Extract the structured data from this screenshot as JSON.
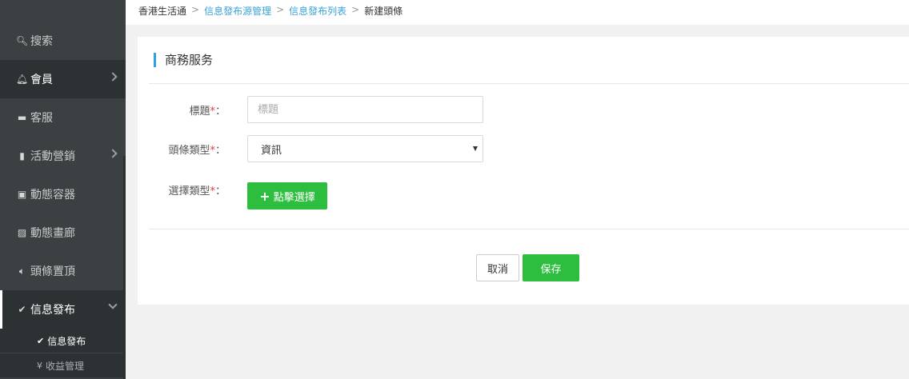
{
  "sidebar": {
    "items": [
      {
        "icon": "search-icon",
        "glyph": "🔍︎",
        "label": "搜索"
      },
      {
        "icon": "bell-icon",
        "glyph": "🔔︎",
        "label": "會員"
      },
      {
        "icon": "chat-icon",
        "glyph": "▬",
        "label": "客服"
      },
      {
        "icon": "bookmark-icon",
        "glyph": "▮",
        "label": "活動營銷"
      },
      {
        "icon": "inbox-icon",
        "glyph": "▣",
        "label": "動態容器"
      },
      {
        "icon": "picture-icon",
        "glyph": "▨",
        "label": "動態畫廊"
      },
      {
        "icon": "volume-icon",
        "glyph": "🔈︎",
        "label": "頭條置頂"
      },
      {
        "icon": "check-edit-icon",
        "glyph": "✔",
        "label": "信息發布"
      }
    ],
    "sub_items": [
      {
        "icon": "check-edit-icon",
        "glyph": "✔",
        "label": "信息發布"
      },
      {
        "icon": "yen-icon",
        "glyph": "¥",
        "label": "收益管理"
      }
    ]
  },
  "breadcrumb": {
    "home": "香港生活通",
    "level1": "信息發布源管理",
    "level2": "信息發布列表",
    "current": "新建頭條",
    "separator": ">"
  },
  "card": {
    "title": "商務服务"
  },
  "form": {
    "title_label": "標題",
    "title_placeholder": "標題",
    "type_label": "頭條類型",
    "type_value": "資訊",
    "select_label": "選擇類型",
    "pick_button": "點擊選擇",
    "required_mark": "*",
    "colon": "："
  },
  "actions": {
    "cancel": "取消",
    "save": "保存"
  },
  "colors": {
    "sidebar_bg": "#3b4142",
    "accent_blue": "#2ea1e4",
    "link_blue": "#3aa2d8",
    "primary_green": "#2dbe3f",
    "required_red": "#e03b3b"
  }
}
